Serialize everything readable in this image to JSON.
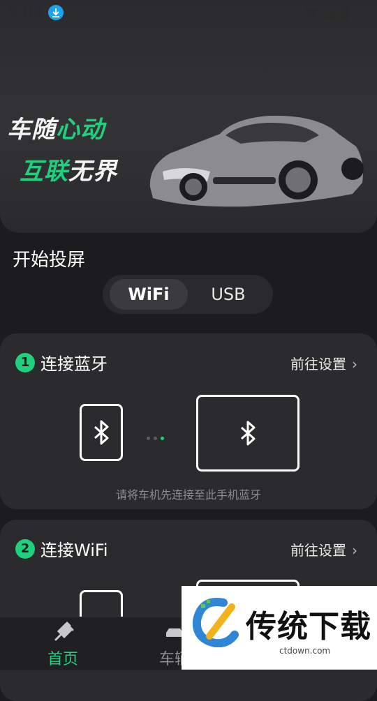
{
  "status_bar": {
    "time": "9:09"
  },
  "hero": {
    "slogan_line1_white": "车随",
    "slogan_line1_green": "心动",
    "slogan_line2_green": "互联",
    "slogan_line2_white": "无界"
  },
  "section_title": "开始投屏",
  "connection_modes": {
    "options": [
      "WiFi",
      "USB"
    ],
    "selected": "WiFi"
  },
  "steps": [
    {
      "number": "1",
      "title": "连接蓝牙",
      "action": "前往设置",
      "hint": "请将车机先连接至此手机蓝牙"
    },
    {
      "number": "2",
      "title": "连接WiFi",
      "action": "前往设置"
    }
  ],
  "tab_bar": {
    "items": [
      "首页",
      "车辆"
    ],
    "active": "首页"
  },
  "watermark": {
    "title": "传统下载",
    "url": "ctdown.com"
  },
  "colors": {
    "accent": "#1fd17d",
    "background": "#1c1c1e",
    "card": "#2b2b2d"
  }
}
